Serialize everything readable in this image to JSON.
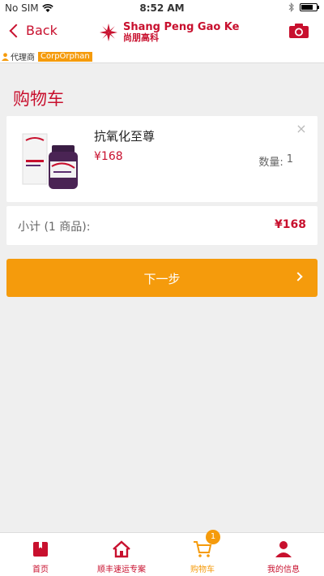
{
  "status_bar": {
    "carrier": "No SIM",
    "time": "8:52 AM"
  },
  "nav": {
    "back_label": "Back",
    "logo_en": "Shang Peng Gao Ke",
    "logo_cn": "尚朋高科",
    "accent_color": "#c8102e"
  },
  "agent": {
    "label": "代理商",
    "name": "CorpOrphan"
  },
  "page": {
    "title": "购物车"
  },
  "cart": {
    "items": [
      {
        "name": "抗氧化至尊",
        "price": "¥168",
        "qty_label": "数量:",
        "qty": "1",
        "remove": "×"
      }
    ],
    "subtotal_label": "小计 (1 商品):",
    "subtotal_value": "¥168"
  },
  "next_button": {
    "label": "下一步",
    "color": "#f59b0c"
  },
  "tabs": [
    {
      "label": "首页",
      "icon": "book-icon"
    },
    {
      "label": "顺丰速运专案",
      "icon": "home-icon"
    },
    {
      "label": "购物车",
      "icon": "cart-icon",
      "badge": "1",
      "active": true
    },
    {
      "label": "我的信息",
      "icon": "user-icon"
    }
  ]
}
